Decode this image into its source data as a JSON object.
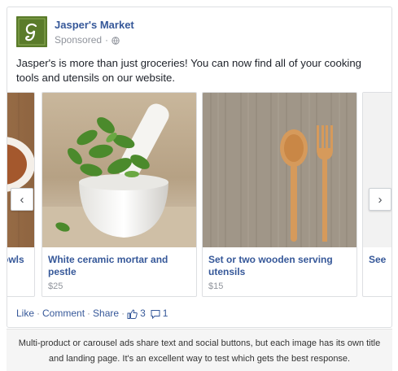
{
  "post": {
    "page_name": "Jasper's Market",
    "sponsored_label": "Sponsored",
    "meta_separator": "·",
    "body_text": "Jasper's is more than just groceries! You can now find all of your cooking tools and utensils on our website.",
    "logo_icon": "jaspers-logo-icon",
    "brand_color": "#5a7b2a",
    "link_color": "#365899"
  },
  "carousel": {
    "prev_icon": "chevron-left-icon",
    "next_icon": "chevron-right-icon",
    "prev_glyph": "‹",
    "next_glyph": "›",
    "cards": [
      {
        "title": "owls",
        "price": "",
        "image": "bowl-photo"
      },
      {
        "title": "White ceramic mortar and pestle",
        "price": "$25",
        "image": "mortar-pestle-photo"
      },
      {
        "title": "Set or two wooden serving utensils",
        "price": "$15",
        "image": "wooden-utensils-photo"
      },
      {
        "title": "See",
        "price": "",
        "image": "next-card-photo"
      }
    ]
  },
  "social": {
    "like": "Like",
    "comment": "Comment",
    "share": "Share",
    "separator": "·",
    "like_count": "3",
    "comment_count": "1"
  },
  "caption": {
    "text": "Multi-product or carousel ads share text and social buttons, but each image has its own title and landing page. It's an excellent way to test which gets the best response."
  }
}
